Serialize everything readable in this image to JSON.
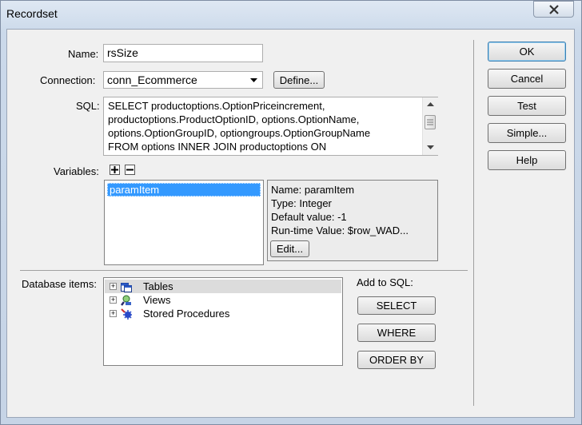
{
  "window": {
    "title": "Recordset"
  },
  "form": {
    "name_label": "Name:",
    "name_value": "rsSize",
    "connection_label": "Connection:",
    "connection_value": "conn_Ecommerce",
    "define_label": "Define...",
    "sql_label": "SQL:",
    "sql_lines": [
      "SELECT productoptions.OptionPriceincrement,",
      "productoptions.ProductOptionID, options.OptionName,",
      "options.OptionGroupID, optiongroups.OptionGroupName",
      "FROM options INNER JOIN productoptions ON"
    ],
    "variables_label": "Variables:",
    "variables": [
      "paramItem"
    ],
    "variable_details": {
      "name": "Name: paramItem",
      "type": "Type: Integer",
      "default": "Default value: -1",
      "runtime": "Run-time Value: $row_WAD..."
    },
    "edit_label": "Edit...",
    "db_items_label": "Database items:",
    "db_items": [
      "Tables",
      "Views",
      "Stored Procedures"
    ],
    "add_to_sql_label": "Add to SQL:",
    "select_label": "SELECT",
    "where_label": "WHERE",
    "orderby_label": "ORDER BY"
  },
  "side_buttons": {
    "ok": "OK",
    "cancel": "Cancel",
    "test": "Test",
    "simple": "Simple...",
    "help": "Help"
  }
}
